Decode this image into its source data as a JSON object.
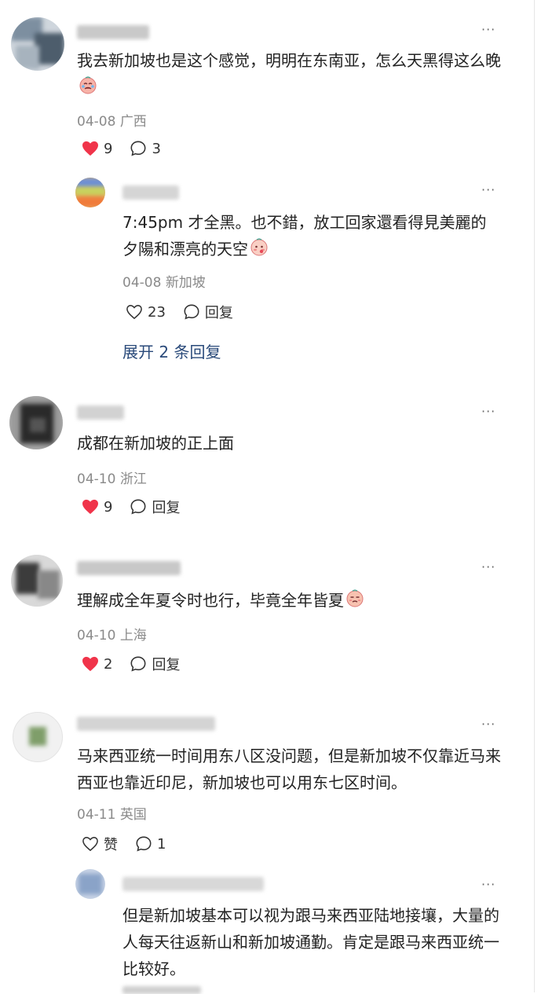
{
  "comments": [
    {
      "text": "我去新加坡也是这个感觉，明明在东南亚，怎么天黑得这么晚",
      "emoji": "crying-face",
      "date": "04-08",
      "location": "广西",
      "likes": "9",
      "replies": "3",
      "liked": true
    },
    {
      "text": "成都在新加坡的正上面",
      "date": "04-10",
      "location": "浙江",
      "likes": "9",
      "reply_label": "回复",
      "liked": true
    },
    {
      "text": "理解成全年夏令时也行，毕竟全年皆夏",
      "emoji": "smirk-face",
      "date": "04-10",
      "location": "上海",
      "likes": "2",
      "reply_label": "回复",
      "liked": true
    },
    {
      "text": "马来西亚统一时间用东八区没问题，但是新加坡不仅靠近马来西亚也靠近印尼，新加坡也可以用东七区时间。",
      "date": "04-11",
      "location": "英国",
      "like_label": "赞",
      "replies": "1",
      "liked": false
    }
  ],
  "replies": [
    {
      "text": "7:45pm 才全黑。也不錯，放工回家還看得見美麗的夕陽和漂亮的天空",
      "emoji": "shy-face",
      "date": "04-08",
      "location": "新加坡",
      "likes": "23",
      "reply_label": "回复",
      "liked": false
    },
    {
      "text": "但是新加坡基本可以视为跟马来西亚陆地接壤，大量的人每天往返新山和新加坡通勤。肯定是跟马来西亚统一比较好。"
    }
  ],
  "expand_label": "展开 2 条回复",
  "more_label": "···",
  "colors": {
    "like_red": "#f0344a",
    "link_blue": "#2a4a7a",
    "meta_gray": "#8a8a8a"
  }
}
